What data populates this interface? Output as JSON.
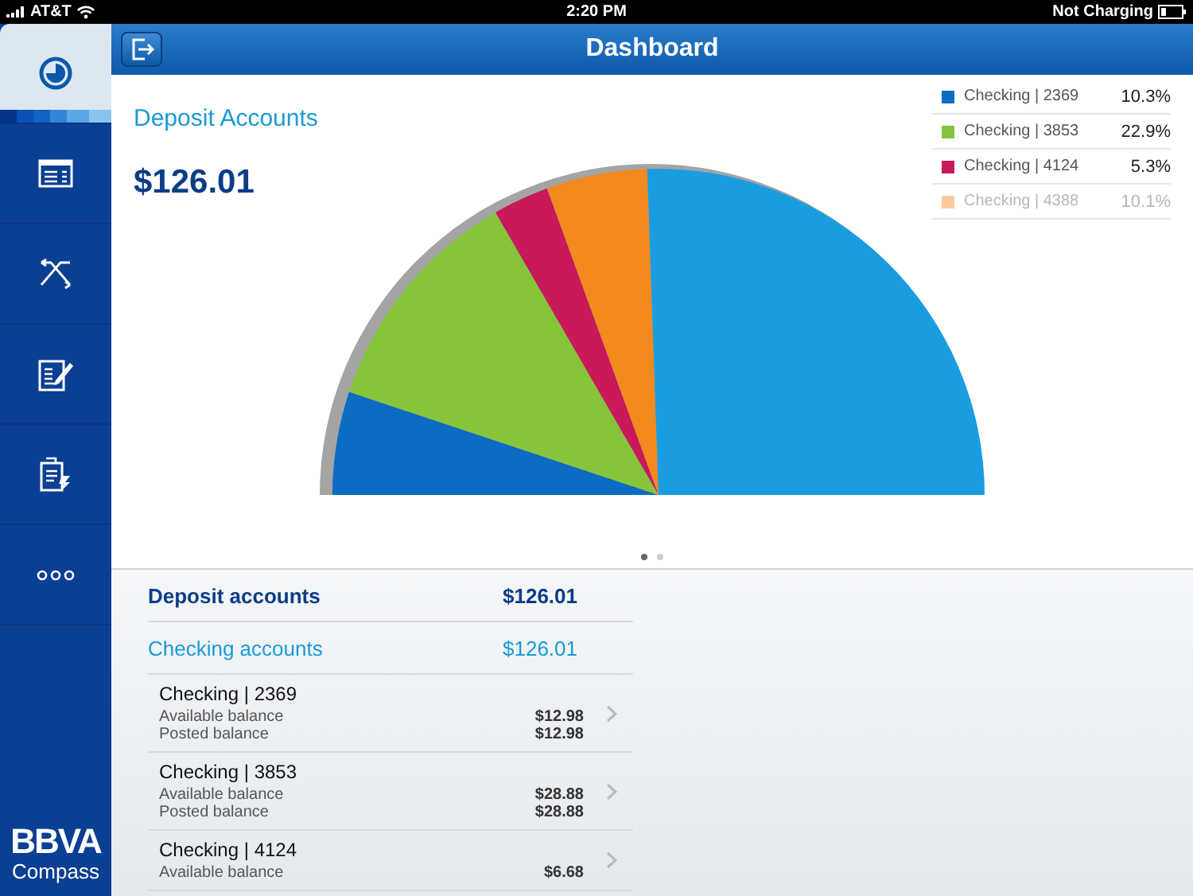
{
  "status_bar": {
    "carrier": "AT&T",
    "time": "2:20 PM",
    "battery_text": "Not Charging"
  },
  "sidebar": {
    "items": [
      {
        "kind": "pie",
        "selected": true
      },
      {
        "kind": "card",
        "selected": false
      },
      {
        "kind": "transfer",
        "selected": false
      },
      {
        "kind": "edit",
        "selected": false
      },
      {
        "kind": "deposit",
        "selected": false
      },
      {
        "kind": "more",
        "selected": false
      }
    ],
    "logo": {
      "brand": "BBVA",
      "sub": "Compass"
    }
  },
  "header": {
    "title": "Dashboard"
  },
  "chart_panel": {
    "title": "Deposit Accounts",
    "amount": "$126.01",
    "legend": [
      {
        "label": "Checking | 2369",
        "percent": "10.3%",
        "color": "#0a6cc2",
        "faded": false
      },
      {
        "label": "Checking | 3853",
        "percent": "22.9%",
        "color": "#86c43a",
        "faded": false
      },
      {
        "label": "Checking | 4124",
        "percent": "5.3%",
        "color": "#c8195b",
        "faded": false
      },
      {
        "label": "Checking | 4388",
        "percent": "10.1%",
        "color": "#fbc99b",
        "faded": true
      }
    ],
    "pages": [
      {
        "selected": true
      },
      {
        "selected": false
      }
    ]
  },
  "summary": {
    "label": "Deposit accounts",
    "amount": "$126.01"
  },
  "group": {
    "label": "Checking accounts",
    "amount": "$126.01"
  },
  "accounts": [
    {
      "name": "Checking | 2369",
      "lines": [
        {
          "label": "Available balance",
          "value": "$12.98"
        },
        {
          "label": "Posted balance",
          "value": "$12.98"
        }
      ]
    },
    {
      "name": "Checking | 3853",
      "lines": [
        {
          "label": "Available balance",
          "value": "$28.88"
        },
        {
          "label": "Posted balance",
          "value": "$28.88"
        }
      ]
    },
    {
      "name": "Checking | 4124",
      "lines": [
        {
          "label": "Available balance",
          "value": "$6.68"
        }
      ]
    }
  ]
}
